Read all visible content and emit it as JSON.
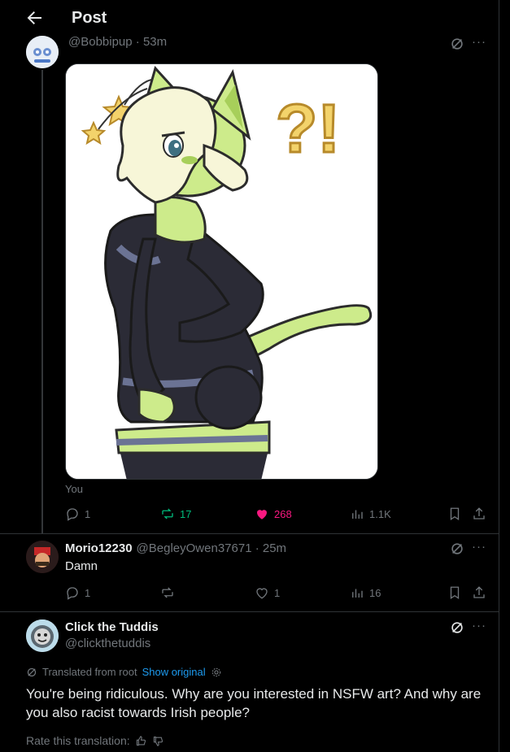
{
  "header": {
    "title": "Post",
    "back_icon": "arrow-left-icon"
  },
  "original_post": {
    "handle_time": "@Bobbipup · 53m",
    "media_alt": "cat girl illustration with ?! symbols",
    "media_caption": "You",
    "actions": {
      "replies": "1",
      "reposts": "17",
      "likes": "268",
      "views": "1.1K"
    },
    "colors": {
      "repost": "#00ba7c",
      "like": "#f91880"
    }
  },
  "reply1": {
    "name": "Morio12230",
    "handle_time": "@BegleyOwen37671 · 25m",
    "text": "Damn",
    "actions": {
      "replies": "1",
      "reposts": "",
      "likes": "1",
      "views": "16"
    }
  },
  "reply2": {
    "name": "Click the Tuddis",
    "handle": "@clickthetuddis",
    "translated_label": "Translated from root",
    "show_original": "Show original",
    "text": "You're being ridiculous. Why are you interested in NSFW art? And why are you also racist towards Irish people?",
    "rate_label": "Rate this translation:"
  }
}
